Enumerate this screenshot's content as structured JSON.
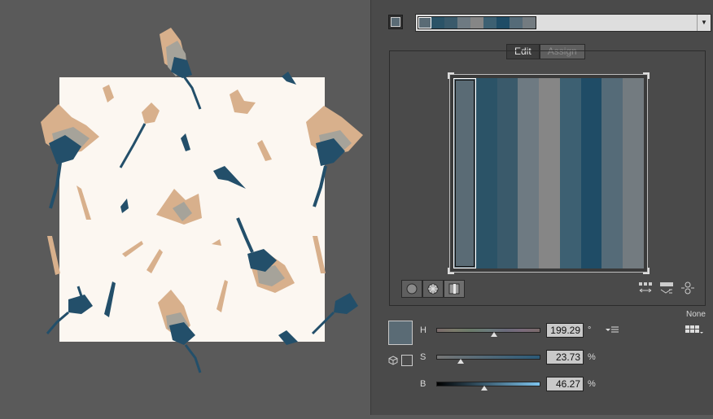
{
  "colors": {
    "pattern_bg": "#fcf7f1",
    "flower_blue": "#234f6a",
    "flower_peach": "#d8b08c",
    "flower_grey": "#a6a39a",
    "panel_bg": "#4a4a4a",
    "canvas_bg": "#5a5a5a"
  },
  "color_group": {
    "chips": [
      "#5a6b75",
      "#2b5367",
      "#3a5a6b",
      "#6e7a82",
      "#868686",
      "#3d6072",
      "#1f4c66",
      "#556b78",
      "#737b80"
    ]
  },
  "tabs": [
    {
      "label": "Edit",
      "active": true
    },
    {
      "label": "Assign",
      "active": false
    }
  ],
  "color_strips": [
    "#5a6b75",
    "#2b5367",
    "#3a5a6b",
    "#6e7a82",
    "#868686",
    "#3d6072",
    "#1f4c66",
    "#556b78",
    "#737b80"
  ],
  "view_buttons": [
    "smooth-wheel-icon",
    "segmented-wheel-icon",
    "color-bars-icon"
  ],
  "tool_icons": [
    "redistribute-icon",
    "randomize-order-icon",
    "link-harmony-icon"
  ],
  "recolor_option": "None",
  "selected_color": "#5a6b75",
  "hsb": {
    "h": {
      "label": "H",
      "value": "199.29",
      "unit": "°",
      "fraction": 0.553
    },
    "s": {
      "label": "S",
      "value": "23.73",
      "unit": "%",
      "fraction": 0.237
    },
    "b": {
      "label": "B",
      "value": "46.27",
      "unit": "%",
      "fraction": 0.463
    }
  }
}
